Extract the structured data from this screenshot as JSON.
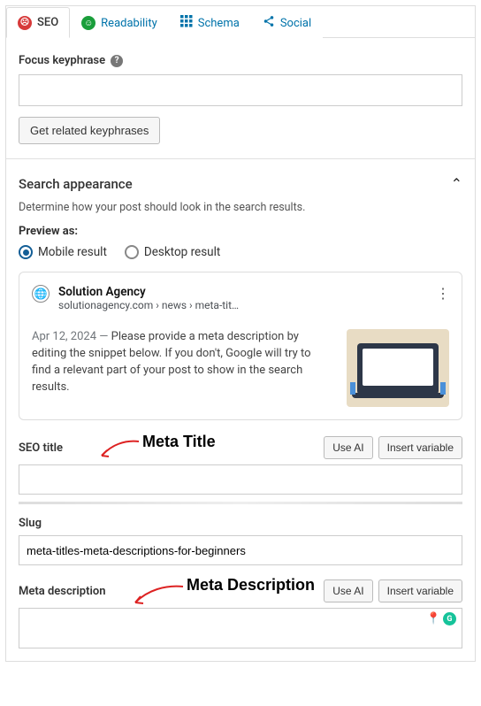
{
  "tabs": {
    "seo": "SEO",
    "readability": "Readability",
    "schema": "Schema",
    "social": "Social"
  },
  "focus_keyphrase": {
    "label": "Focus keyphrase",
    "value": "",
    "related_button": "Get related keyphrases"
  },
  "search_appearance": {
    "title": "Search appearance",
    "description": "Determine how your post should look in the search results.",
    "preview_as_label": "Preview as:",
    "radio_mobile": "Mobile result",
    "radio_desktop": "Desktop result"
  },
  "preview": {
    "site_name": "Solution Agency",
    "site_url": "solutionagency.com › news › meta-tit…",
    "date": "Apr 12, 2024",
    "separator": " — ",
    "description": "Please provide a meta description by editing the snippet below. If you don't, Google will try to find a relevant part of your post to show in the search results."
  },
  "seo_title": {
    "label": "SEO title",
    "btn_ai": "Use AI",
    "btn_insert": "Insert variable",
    "value": ""
  },
  "slug": {
    "label": "Slug",
    "value": "meta-titles-meta-descriptions-for-beginners"
  },
  "meta_description": {
    "label": "Meta description",
    "btn_ai": "Use AI",
    "btn_insert": "Insert variable",
    "value": ""
  },
  "annotations": {
    "meta_title": "Meta Title",
    "meta_description": "Meta Description"
  }
}
